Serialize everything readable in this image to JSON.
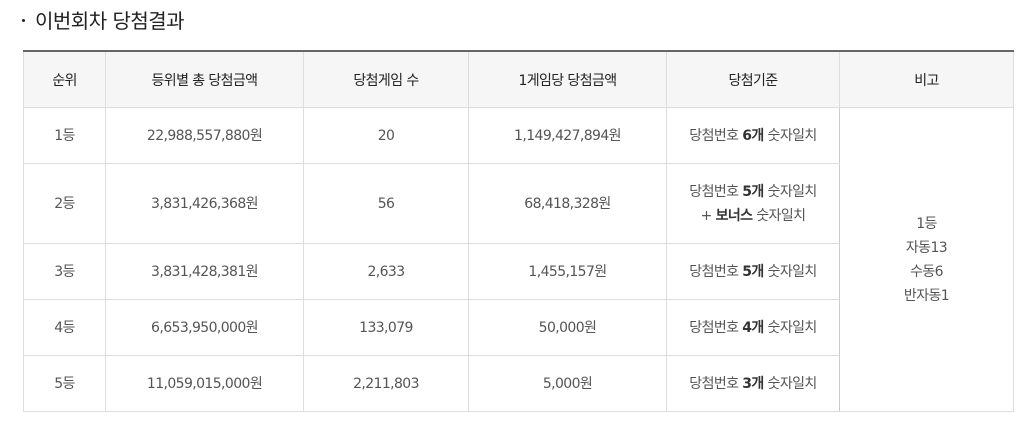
{
  "section": {
    "title": "이번회차 당첨결과"
  },
  "table": {
    "headers": [
      "순위",
      "등위별 총 당첨금액",
      "당첨게임 수",
      "1게임당 당첨금액",
      "당첨기준",
      "비고"
    ],
    "rows": [
      {
        "rank": "1등",
        "total_prize": "22,988,557,880원",
        "winner_count": "20",
        "prize_per_game": "1,149,427,894원",
        "criteria_prefix": "당첨번호 ",
        "criteria_count": "6개",
        "criteria_suffix": " 숫자일치"
      },
      {
        "rank": "2등",
        "total_prize": "3,831,426,368원",
        "winner_count": "56",
        "prize_per_game": "68,418,328원",
        "criteria_prefix": "당첨번호 ",
        "criteria_count": "5개",
        "criteria_suffix": " 숫자일치",
        "criteria_line2_prefix": "+ ",
        "criteria_line2_bold": "보너스",
        "criteria_line2_suffix": " 숫자일치"
      },
      {
        "rank": "3등",
        "total_prize": "3,831,428,381원",
        "winner_count": "2,633",
        "prize_per_game": "1,455,157원",
        "criteria_prefix": "당첨번호 ",
        "criteria_count": "5개",
        "criteria_suffix": " 숫자일치"
      },
      {
        "rank": "4등",
        "total_prize": "6,653,950,000원",
        "winner_count": "133,079",
        "prize_per_game": "50,000원",
        "criteria_prefix": "당첨번호 ",
        "criteria_count": "4개",
        "criteria_suffix": " 숫자일치"
      },
      {
        "rank": "5등",
        "total_prize": "11,059,015,000원",
        "winner_count": "2,211,803",
        "prize_per_game": "5,000원",
        "criteria_prefix": "당첨번호 ",
        "criteria_count": "3개",
        "criteria_suffix": " 숫자일치"
      }
    ],
    "note": {
      "lines": [
        "1등",
        "자동13",
        "수동6",
        "반자동1"
      ]
    }
  },
  "colors": {
    "header_bg": "#f6f6f6",
    "border": "#dddddd",
    "top_border": "#666666",
    "text": "#555555"
  }
}
